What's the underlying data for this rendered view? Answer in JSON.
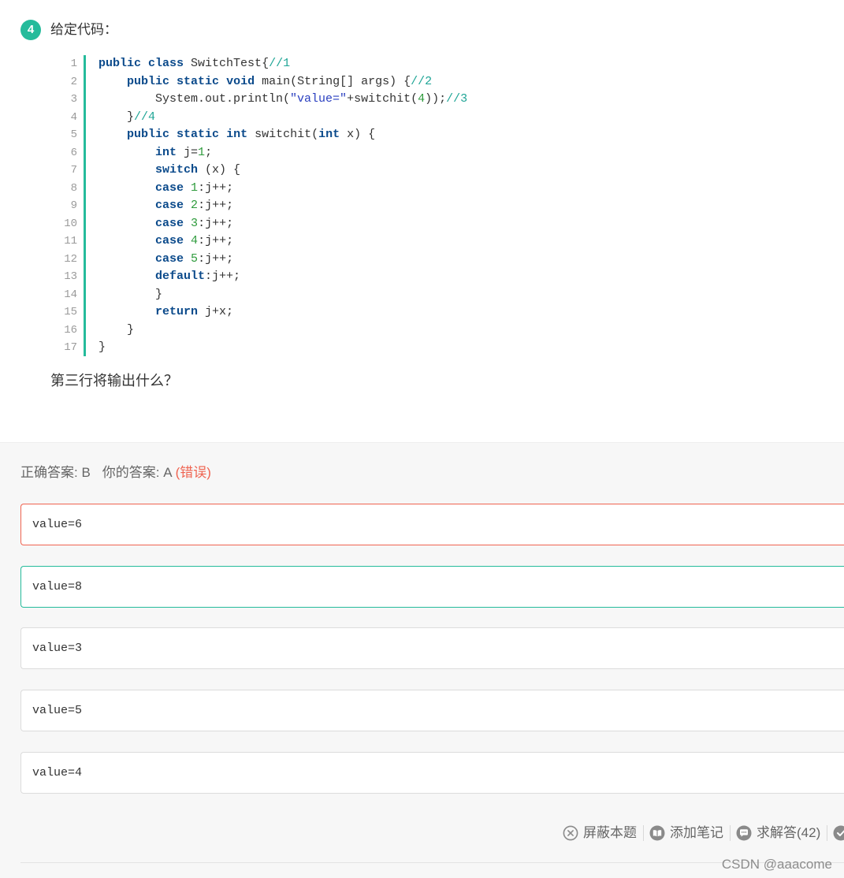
{
  "question": {
    "number": "4",
    "prompt": "给定代码：",
    "code_lines": [
      {
        "n": "1",
        "tokens": [
          [
            "kw",
            "public"
          ],
          [
            "t",
            " "
          ],
          [
            "kw",
            "class"
          ],
          [
            "t",
            " SwitchTest{"
          ],
          [
            "cm",
            "//1"
          ]
        ]
      },
      {
        "n": "2",
        "tokens": [
          [
            "t",
            "    "
          ],
          [
            "kw",
            "public"
          ],
          [
            "t",
            " "
          ],
          [
            "kw",
            "static"
          ],
          [
            "t",
            " "
          ],
          [
            "kw",
            "void"
          ],
          [
            "t",
            " main(String[] args) {"
          ],
          [
            "cm",
            "//2"
          ]
        ]
      },
      {
        "n": "3",
        "tokens": [
          [
            "t",
            "        System.out.println("
          ],
          [
            "str",
            "\"value=\""
          ],
          [
            "t",
            "+switchit("
          ],
          [
            "num",
            "4"
          ],
          [
            "t",
            "));"
          ],
          [
            "cm",
            "//3"
          ]
        ]
      },
      {
        "n": "4",
        "tokens": [
          [
            "t",
            "    }"
          ],
          [
            "cm",
            "//4"
          ]
        ]
      },
      {
        "n": "5",
        "tokens": [
          [
            "t",
            "    "
          ],
          [
            "kw",
            "public"
          ],
          [
            "t",
            " "
          ],
          [
            "kw",
            "static"
          ],
          [
            "t",
            " "
          ],
          [
            "kw",
            "int"
          ],
          [
            "t",
            " switchit("
          ],
          [
            "kw",
            "int"
          ],
          [
            "t",
            " x) {"
          ]
        ]
      },
      {
        "n": "6",
        "tokens": [
          [
            "t",
            "        "
          ],
          [
            "kw",
            "int"
          ],
          [
            "t",
            " j="
          ],
          [
            "num",
            "1"
          ],
          [
            "t",
            ";"
          ]
        ]
      },
      {
        "n": "7",
        "tokens": [
          [
            "t",
            "        "
          ],
          [
            "kw",
            "switch"
          ],
          [
            "t",
            " (x) {"
          ]
        ]
      },
      {
        "n": "8",
        "tokens": [
          [
            "t",
            "        "
          ],
          [
            "kw",
            "case"
          ],
          [
            "t",
            " "
          ],
          [
            "num",
            "1"
          ],
          [
            "t",
            ":j++;"
          ]
        ]
      },
      {
        "n": "9",
        "tokens": [
          [
            "t",
            "        "
          ],
          [
            "kw",
            "case"
          ],
          [
            "t",
            " "
          ],
          [
            "num",
            "2"
          ],
          [
            "t",
            ":j++;"
          ]
        ]
      },
      {
        "n": "10",
        "tokens": [
          [
            "t",
            "        "
          ],
          [
            "kw",
            "case"
          ],
          [
            "t",
            " "
          ],
          [
            "num",
            "3"
          ],
          [
            "t",
            ":j++;"
          ]
        ]
      },
      {
        "n": "11",
        "tokens": [
          [
            "t",
            "        "
          ],
          [
            "kw",
            "case"
          ],
          [
            "t",
            " "
          ],
          [
            "num",
            "4"
          ],
          [
            "t",
            ":j++;"
          ]
        ]
      },
      {
        "n": "12",
        "tokens": [
          [
            "t",
            "        "
          ],
          [
            "kw",
            "case"
          ],
          [
            "t",
            " "
          ],
          [
            "num",
            "5"
          ],
          [
            "t",
            ":j++;"
          ]
        ]
      },
      {
        "n": "13",
        "tokens": [
          [
            "t",
            "        "
          ],
          [
            "kw",
            "default"
          ],
          [
            "t",
            ":j++;"
          ]
        ]
      },
      {
        "n": "14",
        "tokens": [
          [
            "t",
            "        }"
          ]
        ]
      },
      {
        "n": "15",
        "tokens": [
          [
            "t",
            "        "
          ],
          [
            "kw",
            "return"
          ],
          [
            "t",
            " j+x;"
          ]
        ]
      },
      {
        "n": "16",
        "tokens": [
          [
            "t",
            "    }"
          ]
        ]
      },
      {
        "n": "17",
        "tokens": [
          [
            "t",
            "}"
          ]
        ]
      }
    ],
    "ask": "第三行将输出什么？"
  },
  "answer": {
    "correct_label": "正确答案: B",
    "yours_label": "你的答案: A",
    "status": "(错误)"
  },
  "options": [
    {
      "text": "value=6",
      "state": "wrong"
    },
    {
      "text": "value=8",
      "state": "correct"
    },
    {
      "text": "value=3",
      "state": "normal"
    },
    {
      "text": "value=5",
      "state": "normal"
    },
    {
      "text": "value=4",
      "state": "normal"
    }
  ],
  "actions": [
    {
      "label": "屏蔽本题",
      "icon": "close-circle-icon"
    },
    {
      "label": "添加笔记",
      "icon": "book-icon"
    },
    {
      "label": "求解答(42)",
      "icon": "chat-bubble-icon"
    },
    {
      "icon": "partial-action-icon"
    }
  ],
  "watermark": "CSDN @aaacome",
  "colors": {
    "accent": "#25bb9b",
    "wrong": "#ef6350",
    "keyword": "#0b4a8b",
    "comment": "#1fa596",
    "number": "#2e9b3c",
    "string": "#2a3fc0"
  }
}
